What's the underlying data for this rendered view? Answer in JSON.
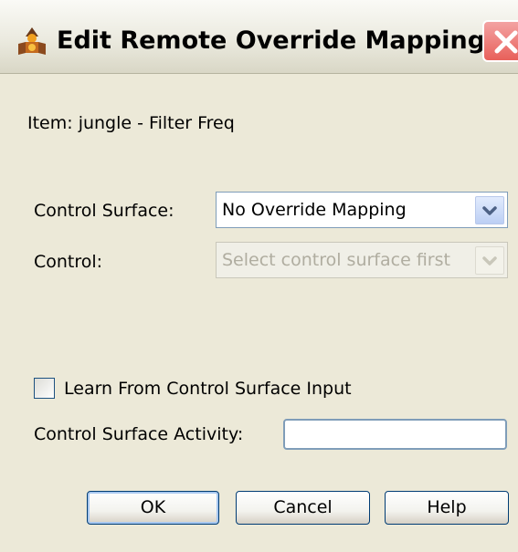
{
  "window": {
    "title": "Edit Remote Override Mapping",
    "icon": "reason-app-icon",
    "close_icon": "close-icon"
  },
  "item_label": "Item: jungle - Filter Freq",
  "control_surface": {
    "label": "Control Surface:",
    "value": "No Override Mapping",
    "enabled": true
  },
  "control": {
    "label": "Control:",
    "value": "Select control surface first",
    "enabled": false
  },
  "learn_checkbox": {
    "label": "Learn From Control Surface Input",
    "checked": false
  },
  "activity": {
    "label": "Control Surface Activity:",
    "value": ""
  },
  "buttons": {
    "ok": "OK",
    "cancel": "Cancel",
    "help": "Help"
  },
  "colors": {
    "dialog_bg": "#ece9d8",
    "accent_border": "#003c74",
    "field_border": "#7f9db9",
    "close_red": "#e8605a"
  }
}
